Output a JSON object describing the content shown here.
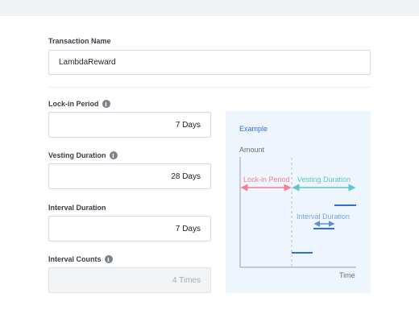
{
  "form": {
    "transaction_name": {
      "label": "Transaction Name",
      "value": "LambdaReward"
    },
    "lock_in_period": {
      "label": "Lock-in Period",
      "value": "7 Days"
    },
    "vesting_duration": {
      "label": "Vesting Duration",
      "value": "28 Days"
    },
    "interval_duration": {
      "label": "Interval Duration",
      "value": "7 Days"
    },
    "interval_counts": {
      "label": "Interval Counts",
      "value": "4 Times"
    }
  },
  "info_icon_glyph": "i",
  "example": {
    "title": "Example",
    "y_axis_label": "Amount",
    "x_axis_label": "Time",
    "lock_in_label": "Lock-in Period",
    "vesting_label": "Vesting Duration",
    "interval_label": "Interval Duration",
    "colors": {
      "lock_in": "#f27f92",
      "vesting": "#5cc8c8",
      "interval": "#7aa3d8",
      "step": "#2f6fd6",
      "title": "#2f6fd6",
      "axis": "#9aa0a8"
    }
  }
}
